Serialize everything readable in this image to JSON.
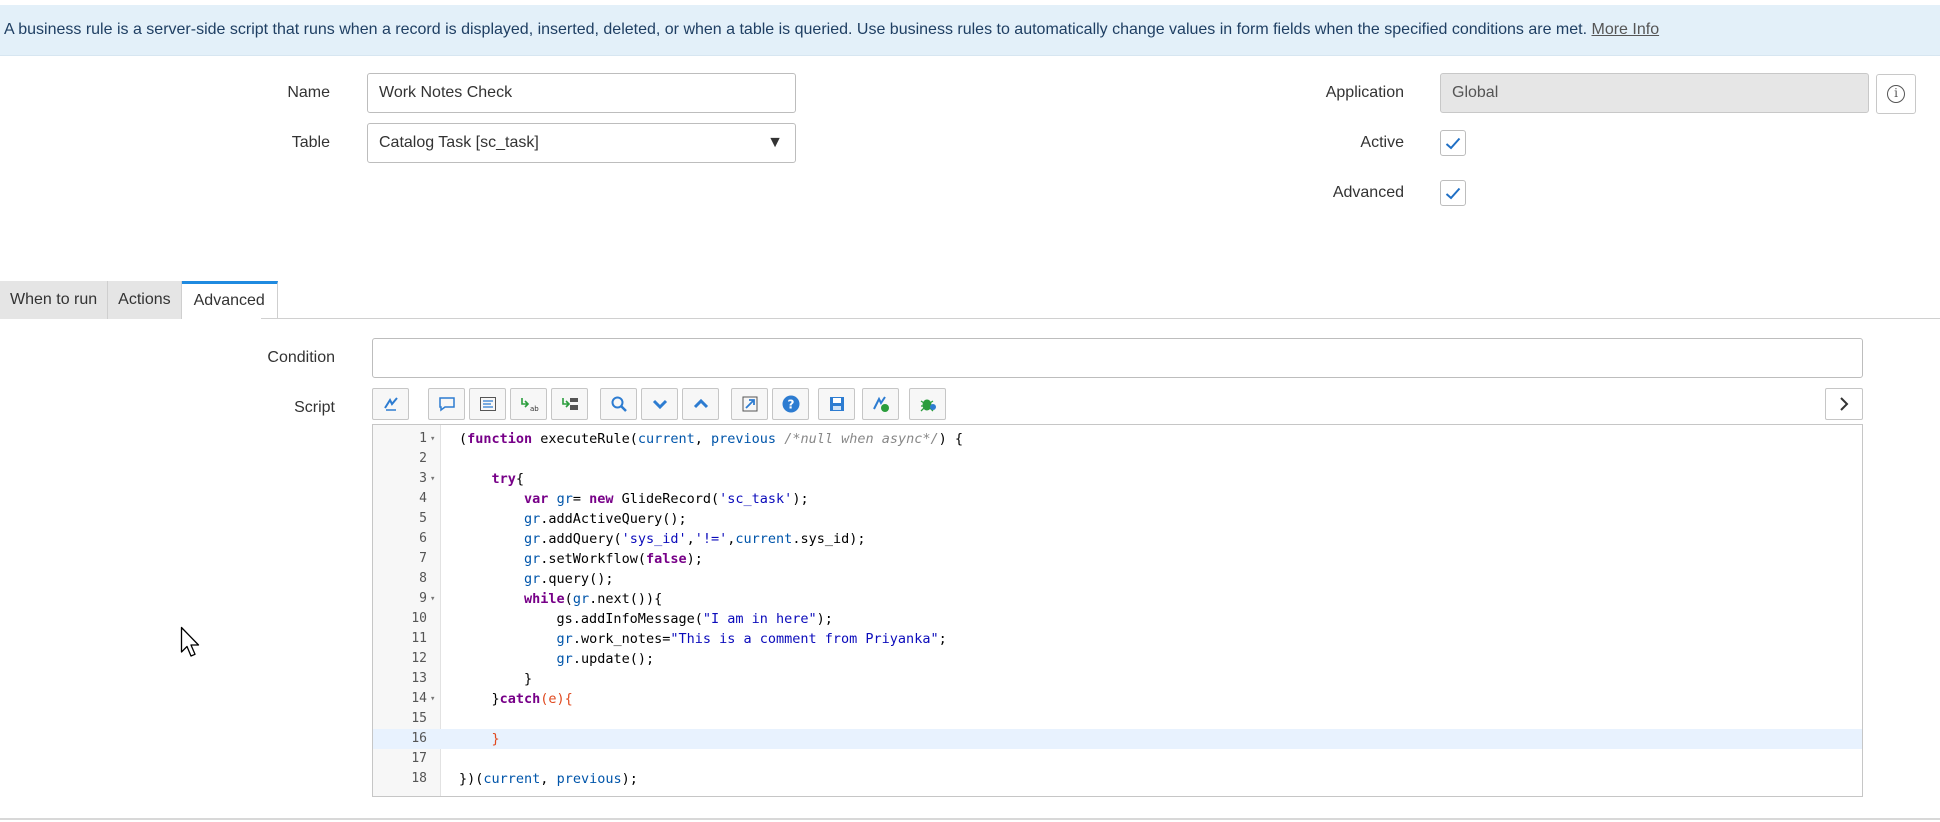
{
  "banner": {
    "text": "A business rule is a server-side script that runs when a record is displayed, inserted, deleted, or when a table is queried. Use business rules to automatically change values in form fields when the specified conditions are met.",
    "link": "More Info"
  },
  "form": {
    "name_label": "Name",
    "name_value": "Work Notes Check",
    "table_label": "Table",
    "table_value": "Catalog Task [sc_task]",
    "table_arrow": "▼",
    "application_label": "Application",
    "application_value": "Global",
    "active_label": "Active",
    "active_checked": true,
    "advanced_label": "Advanced",
    "advanced_checked": true
  },
  "tabs": [
    {
      "label": "When to run",
      "active": false
    },
    {
      "label": "Actions",
      "active": false
    },
    {
      "label": "Advanced",
      "active": true
    }
  ],
  "advanced": {
    "condition_label": "Condition",
    "condition_value": "",
    "script_label": "Script"
  },
  "toolbar_icons": [
    "toggle-syntax-icon",
    "comment-icon",
    "format-code-icon",
    "replace-icon",
    "replace-all-icon",
    "search-icon",
    "find-next-icon",
    "find-previous-icon",
    "open-script-icon",
    "help-icon",
    "save-icon",
    "script-debugger-icon",
    "debug-icon"
  ],
  "accent_color": "#1f8ae0",
  "script_lines": [
    {
      "n": "1",
      "fold": true,
      "text": "(function executeRule(current, previous /*null when async*/) {"
    },
    {
      "n": "2",
      "fold": false,
      "text": ""
    },
    {
      "n": "3",
      "fold": true,
      "text": "    try{"
    },
    {
      "n": "4",
      "fold": false,
      "text": "        var gr= new GlideRecord('sc_task');"
    },
    {
      "n": "5",
      "fold": false,
      "text": "        gr.addActiveQuery();"
    },
    {
      "n": "6",
      "fold": false,
      "text": "        gr.addQuery('sys_id','!=',current.sys_id);"
    },
    {
      "n": "7",
      "fold": false,
      "text": "        gr.setWorkflow(false);"
    },
    {
      "n": "8",
      "fold": false,
      "text": "        gr.query();"
    },
    {
      "n": "9",
      "fold": true,
      "text": "        while(gr.next()){"
    },
    {
      "n": "10",
      "fold": false,
      "text": "            gs.addInfoMessage(\"I am in here\");"
    },
    {
      "n": "11",
      "fold": false,
      "text": "            gr.work_notes=\"This is a comment from Priyanka\";"
    },
    {
      "n": "12",
      "fold": false,
      "text": "            gr.update();"
    },
    {
      "n": "13",
      "fold": false,
      "text": "        }"
    },
    {
      "n": "14",
      "fold": true,
      "text": "    }catch(e){"
    },
    {
      "n": "15",
      "fold": false,
      "text": ""
    },
    {
      "n": "16",
      "fold": false,
      "text": "    }"
    },
    {
      "n": "17",
      "fold": false,
      "text": ""
    },
    {
      "n": "18",
      "fold": false,
      "text": "})(current, previous);"
    }
  ]
}
